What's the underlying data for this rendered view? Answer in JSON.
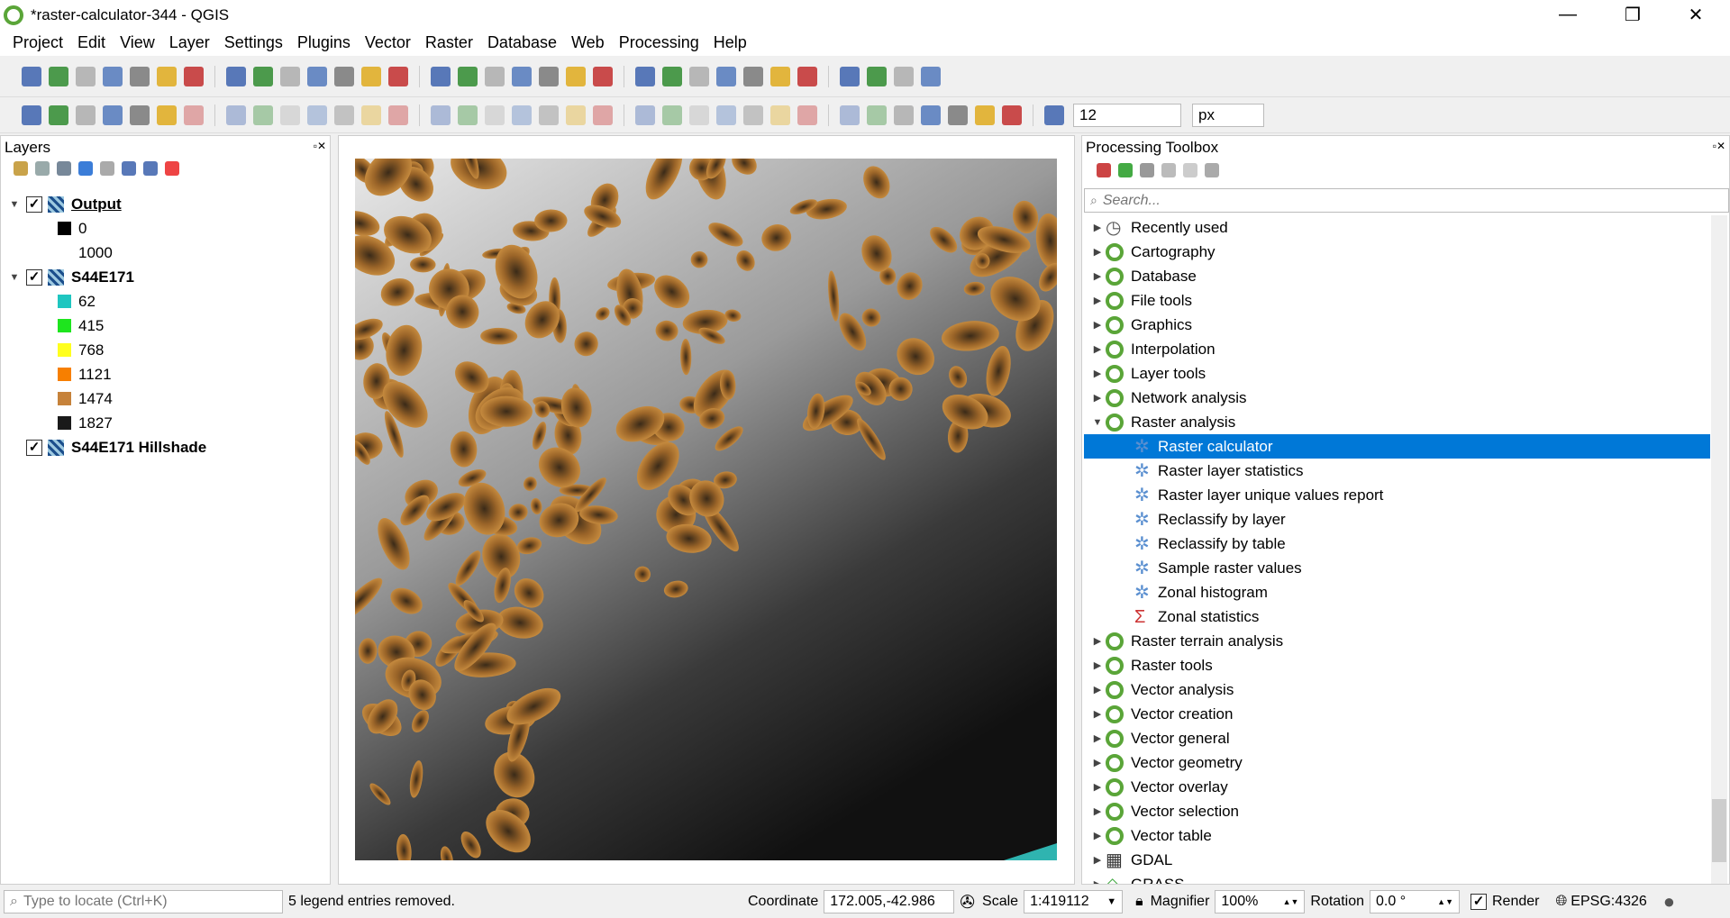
{
  "window": {
    "title": "*raster-calculator-344 - QGIS",
    "min": "—",
    "max": "❐",
    "close": "✕"
  },
  "menu": [
    "Project",
    "Edit",
    "View",
    "Layer",
    "Settings",
    "Plugins",
    "Vector",
    "Raster",
    "Database",
    "Web",
    "Processing",
    "Help"
  ],
  "toolbar1": [
    "new-project",
    "open-project",
    "save-project",
    "save-as",
    "new-print-layout",
    "layout-manager",
    "style-manager",
    "pan",
    "pan-to-selection",
    "zoom-in",
    "zoom-out",
    "zoom-native",
    "zoom-full",
    "zoom-to-selection",
    "zoom-to-layer",
    "zoom-last",
    "zoom-next",
    "new-bookmark",
    "show-bookmarks",
    "spatial-bookmarks",
    "refresh",
    "identify",
    "actions",
    "select-features",
    "deselect",
    "attribute-table",
    "statistics-summary",
    "processing-toolbox",
    "sigma",
    "measure",
    "map-tips",
    "text-annotation"
  ],
  "toolbar2": [
    "add-vector-layer",
    "add-raster-layer",
    "new-vertex",
    "digitize",
    "new-mesh",
    "current-edits",
    "toggle-editing",
    "save-edits",
    "add-feature",
    "vertex-tool",
    "modify-attributes",
    "delete-selected",
    "cut",
    "copy",
    "paste",
    "undo",
    "redo",
    "digitizing-shape",
    "add-ring",
    "add-part",
    "fill-ring",
    "delete-ring",
    "delete-part",
    "reshape",
    "offset-curve",
    "split",
    "split-parts",
    "merge",
    "merge-attributes",
    "rotate-point",
    "simplify",
    "rotate",
    "snap",
    "tracing",
    "magnet",
    "snapping-mode"
  ],
  "toolbar2_fields": {
    "tolerance": "12",
    "unit": "px"
  },
  "layers": {
    "title": "Layers",
    "items": [
      {
        "type": "layer",
        "name": "Output",
        "checked": true,
        "bold": true,
        "underline": true
      },
      {
        "type": "legend",
        "color": "#000000",
        "label": "0"
      },
      {
        "type": "legend",
        "color": "#ffffff",
        "label": "1000"
      },
      {
        "type": "layer",
        "name": "S44E171",
        "checked": true,
        "bold": true
      },
      {
        "type": "legend",
        "color": "#1fc6c0",
        "label": "62"
      },
      {
        "type": "legend",
        "color": "#1ee51e",
        "label": "415"
      },
      {
        "type": "legend",
        "color": "#ffff1e",
        "label": "768"
      },
      {
        "type": "legend",
        "color": "#f77f00",
        "label": "1121"
      },
      {
        "type": "legend",
        "color": "#c6823a",
        "label": "1474"
      },
      {
        "type": "legend",
        "color": "#1a1a1a",
        "label": "1827"
      },
      {
        "type": "layer",
        "name": "S44E171 Hillshade",
        "checked": true,
        "bold": true,
        "noexpand": true
      }
    ]
  },
  "toolbox": {
    "title": "Processing Toolbox",
    "search_placeholder": "Search...",
    "items": [
      {
        "label": "Recently used",
        "icon": "clock"
      },
      {
        "label": "Cartography"
      },
      {
        "label": "Database"
      },
      {
        "label": "File tools"
      },
      {
        "label": "Graphics"
      },
      {
        "label": "Interpolation"
      },
      {
        "label": "Layer tools"
      },
      {
        "label": "Network analysis"
      },
      {
        "label": "Raster analysis",
        "expanded": true
      },
      {
        "label": "Raster calculator",
        "child": true,
        "selected": true
      },
      {
        "label": "Raster layer statistics",
        "child": true
      },
      {
        "label": "Raster layer unique values report",
        "child": true
      },
      {
        "label": "Reclassify by layer",
        "child": true
      },
      {
        "label": "Reclassify by table",
        "child": true
      },
      {
        "label": "Sample raster values",
        "child": true
      },
      {
        "label": "Zonal histogram",
        "child": true
      },
      {
        "label": "Zonal statistics",
        "child": true,
        "icon": "sigma"
      },
      {
        "label": "Raster terrain analysis"
      },
      {
        "label": "Raster tools"
      },
      {
        "label": "Vector analysis"
      },
      {
        "label": "Vector creation"
      },
      {
        "label": "Vector general"
      },
      {
        "label": "Vector geometry"
      },
      {
        "label": "Vector overlay"
      },
      {
        "label": "Vector selection"
      },
      {
        "label": "Vector table"
      },
      {
        "label": "GDAL",
        "icon": "gdal"
      },
      {
        "label": "GRASS",
        "icon": "grass"
      }
    ]
  },
  "status": {
    "locate_placeholder": "Type to locate (Ctrl+K)",
    "message": "5 legend entries removed.",
    "coordinate_label": "Coordinate",
    "coordinate": "172.005,-42.986",
    "scale_label": "Scale",
    "scale": "1:419112",
    "magnifier_label": "Magnifier",
    "magnifier": "100%",
    "rotation_label": "Rotation",
    "rotation": "0.0 °",
    "render_label": "Render",
    "render_checked": true,
    "crs": "EPSG:4326"
  },
  "colors": {
    "accent": "#0078d7",
    "qgis_green": "#5aa538",
    "terrain": "#b5782f"
  }
}
